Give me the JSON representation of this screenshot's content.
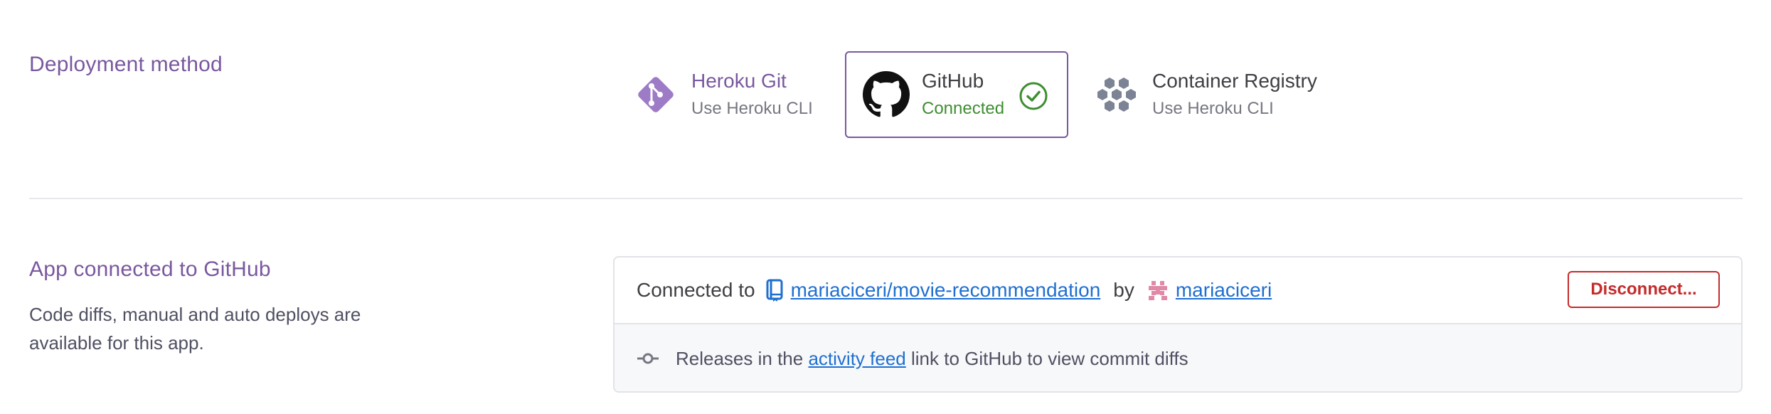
{
  "deployment": {
    "title": "Deployment method",
    "methods": [
      {
        "name": "Heroku Git",
        "subtitle": "Use Heroku CLI",
        "icon": "heroku-git-icon",
        "selected": false
      },
      {
        "name": "GitHub",
        "subtitle": "Connected",
        "icon": "github-icon",
        "selected": true
      },
      {
        "name": "Container Registry",
        "subtitle": "Use Heroku CLI",
        "icon": "container-registry-icon",
        "selected": false
      }
    ]
  },
  "connection": {
    "title": "App connected to GitHub",
    "description": "Code diffs, manual and auto deploys are available for this app.",
    "connected_to_label": "Connected to",
    "repo": "mariaciceri/movie-recommendation",
    "by_label": "by",
    "user": "mariaciceri",
    "disconnect_label": "Disconnect...",
    "releases_prefix": "Releases in the",
    "activity_feed_link": "activity feed",
    "releases_suffix": "link to GitHub to view commit diffs"
  },
  "colors": {
    "accent": "#79589f",
    "success": "#3e8e31",
    "link": "#1f6fd1",
    "danger": "#c42b2b"
  }
}
